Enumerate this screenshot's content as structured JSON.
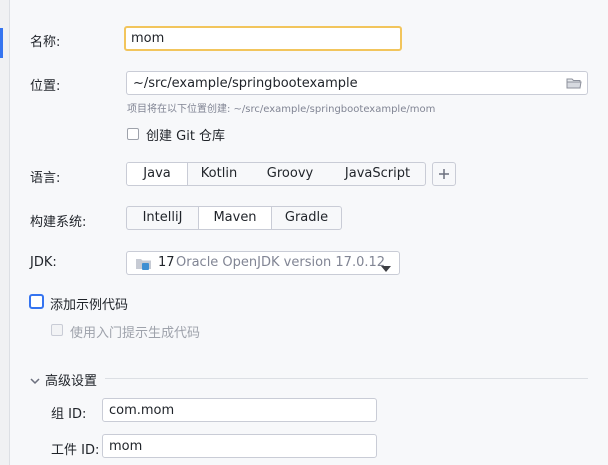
{
  "form": {
    "name_label": "名称:",
    "name_value": "mom",
    "location_label": "位置:",
    "location_value": "~/src/example/springbootexample",
    "location_hint": "项目将在以下位置创建: ~/src/example/springbootexample/mom",
    "git_label": "创建 Git 仓库",
    "language_label": "语言:",
    "languages": [
      "Java",
      "Kotlin",
      "Groovy",
      "JavaScript"
    ],
    "language_selected": "Java",
    "build_label": "构建系统:",
    "build_systems": [
      "IntelliJ",
      "Maven",
      "Gradle"
    ],
    "build_selected": "Maven",
    "jdk_label": "JDK:",
    "jdk_version": "17",
    "jdk_name": "Oracle OpenJDK version 17.0.12",
    "sample_code_label": "添加示例代码",
    "onboarding_label": "使用入门提示生成代码",
    "advanced_title": "高级设置",
    "group_id_label": "组 ID:",
    "group_id_value": "com.mom",
    "artifact_id_label": "工件 ID:",
    "artifact_id_value": "mom"
  },
  "colors": {
    "focus_border": "#f2c55c",
    "accent_blue": "#3574f0",
    "background": "#f7f8fa"
  },
  "icons": [
    "folder-icon",
    "plus-icon",
    "jdk-folder-icon",
    "chevron-down-icon"
  ]
}
